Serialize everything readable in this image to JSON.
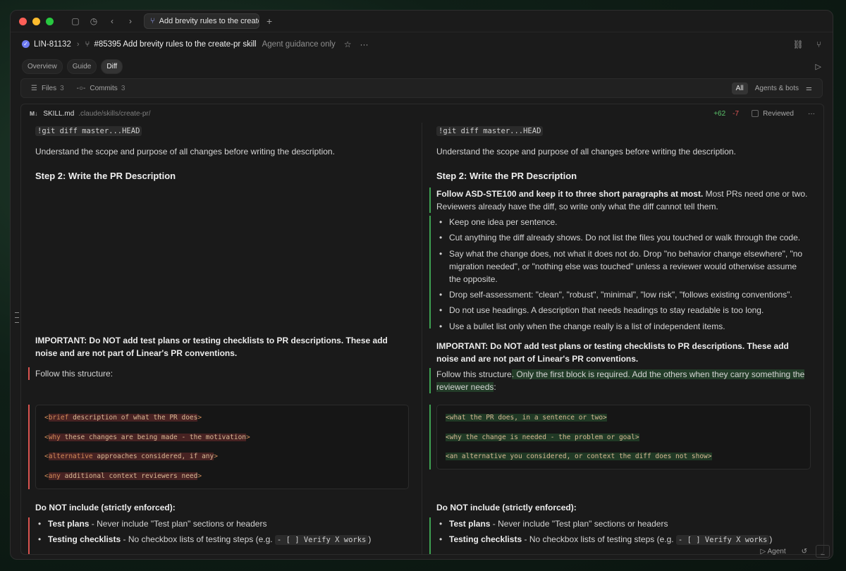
{
  "titlebar": {
    "tab_title": "Add brevity rules to the create-pr skill",
    "add_tab": "+"
  },
  "header": {
    "issue_id": "LIN-81132",
    "pr_title": "#85395 Add brevity rules to the create-pr skill",
    "subtitle": "Agent guidance only"
  },
  "tabs": {
    "overview": "Overview",
    "guide": "Guide",
    "diff": "Diff"
  },
  "toolbar": {
    "files_label": "Files",
    "files_count": "3",
    "commits_label": "Commits",
    "commits_count": "3",
    "filter_all": "All",
    "filter_agents": "Agents & bots"
  },
  "file": {
    "icon_text": "M↓",
    "name": "SKILL.md",
    "path": ".claude/skills/create-pr/",
    "additions": "+62",
    "deletions": "-7",
    "reviewed_label": "Reviewed"
  },
  "left": {
    "code_cmd": "!git diff master...HEAD",
    "understand": "Understand the scope and purpose of all changes before writing the description.",
    "step2": "Step 2: Write the PR Description",
    "important": "IMPORTANT: Do NOT add test plans or testing checklists to PR descriptions. These add noise and are not part of Linear's PR conventions.",
    "follow": "Follow this structure:",
    "code_lines": [
      {
        "tag": "<",
        "hl": "brief",
        "rest": " description of what the PR does",
        "end": ">"
      },
      {
        "tag": "<",
        "hl": "why",
        "rest": " these changes are being made - the motivation",
        "end": ">"
      },
      {
        "tag": "<",
        "hl": "alternative",
        "rest": " approaches considered, if any",
        "end": ">"
      },
      {
        "tag": "<",
        "hl": "any",
        "rest": " additional context reviewers need",
        "end": ">"
      }
    ],
    "not_include": "Do NOT include (strictly enforced):",
    "test_plans_b": "Test plans",
    "test_plans_r": " - Never include \"Test plan\" sections or headers",
    "testing_b": "Testing checklists",
    "testing_r": " - No checkbox lists of testing steps (e.g. ",
    "testing_code": "- [ ] Verify X works",
    "testing_end": ")"
  },
  "right": {
    "code_cmd": "!git diff master...HEAD",
    "understand": "Understand the scope and purpose of all changes before writing the description.",
    "step2": "Step 2: Write the PR Description",
    "follow_bold": "Follow ASD-STE100 and keep it to three short paragraphs at most.",
    "follow_rest": " Most PRs need one or two. Reviewers already have the diff, so write only what the diff cannot tell them.",
    "bullets": [
      "Keep one idea per sentence.",
      "Cut anything the diff already shows. Do not list the files you touched or walk through the code.",
      "Say what the change does, not what it does not do. Drop \"no behavior change elsewhere\", \"no migration needed\", or \"nothing else was touched\" unless a reviewer would otherwise assume the opposite.",
      "Drop self-assessment: \"clean\", \"robust\", \"minimal\", \"low risk\", \"follows existing conventions\".",
      "Do not use headings. A description that needs headings to stay readable is too long.",
      "Use a bullet list only when the change really is a list of independent items."
    ],
    "important": "IMPORTANT: Do NOT add test plans or testing checklists to PR descriptions. These add noise and are not part of Linear's PR conventions.",
    "follow_a": "Follow this structure",
    "follow_b": ". Only the first block is required. Add the others when they carry something the reviewer needs",
    "follow_c": ":",
    "code_lines": [
      "<what the PR does, in a sentence or two>",
      "<why the change is needed - the problem or goal>",
      "<an alternative you considered, or context the diff does not show>"
    ],
    "not_include": "Do NOT include (strictly enforced):",
    "test_plans_b": "Test plans",
    "test_plans_r": " - Never include \"Test plan\" sections or headers",
    "testing_b": "Testing checklists",
    "testing_r": " - No checkbox lists of testing steps (e.g. ",
    "testing_code": "- [ ] Verify X works",
    "testing_end": ")"
  },
  "statusbar": {
    "agent": "Agent"
  },
  "colors": {
    "addition": "#5bc36b",
    "deletion": "#e05757",
    "accent": "#6e7bf2"
  }
}
